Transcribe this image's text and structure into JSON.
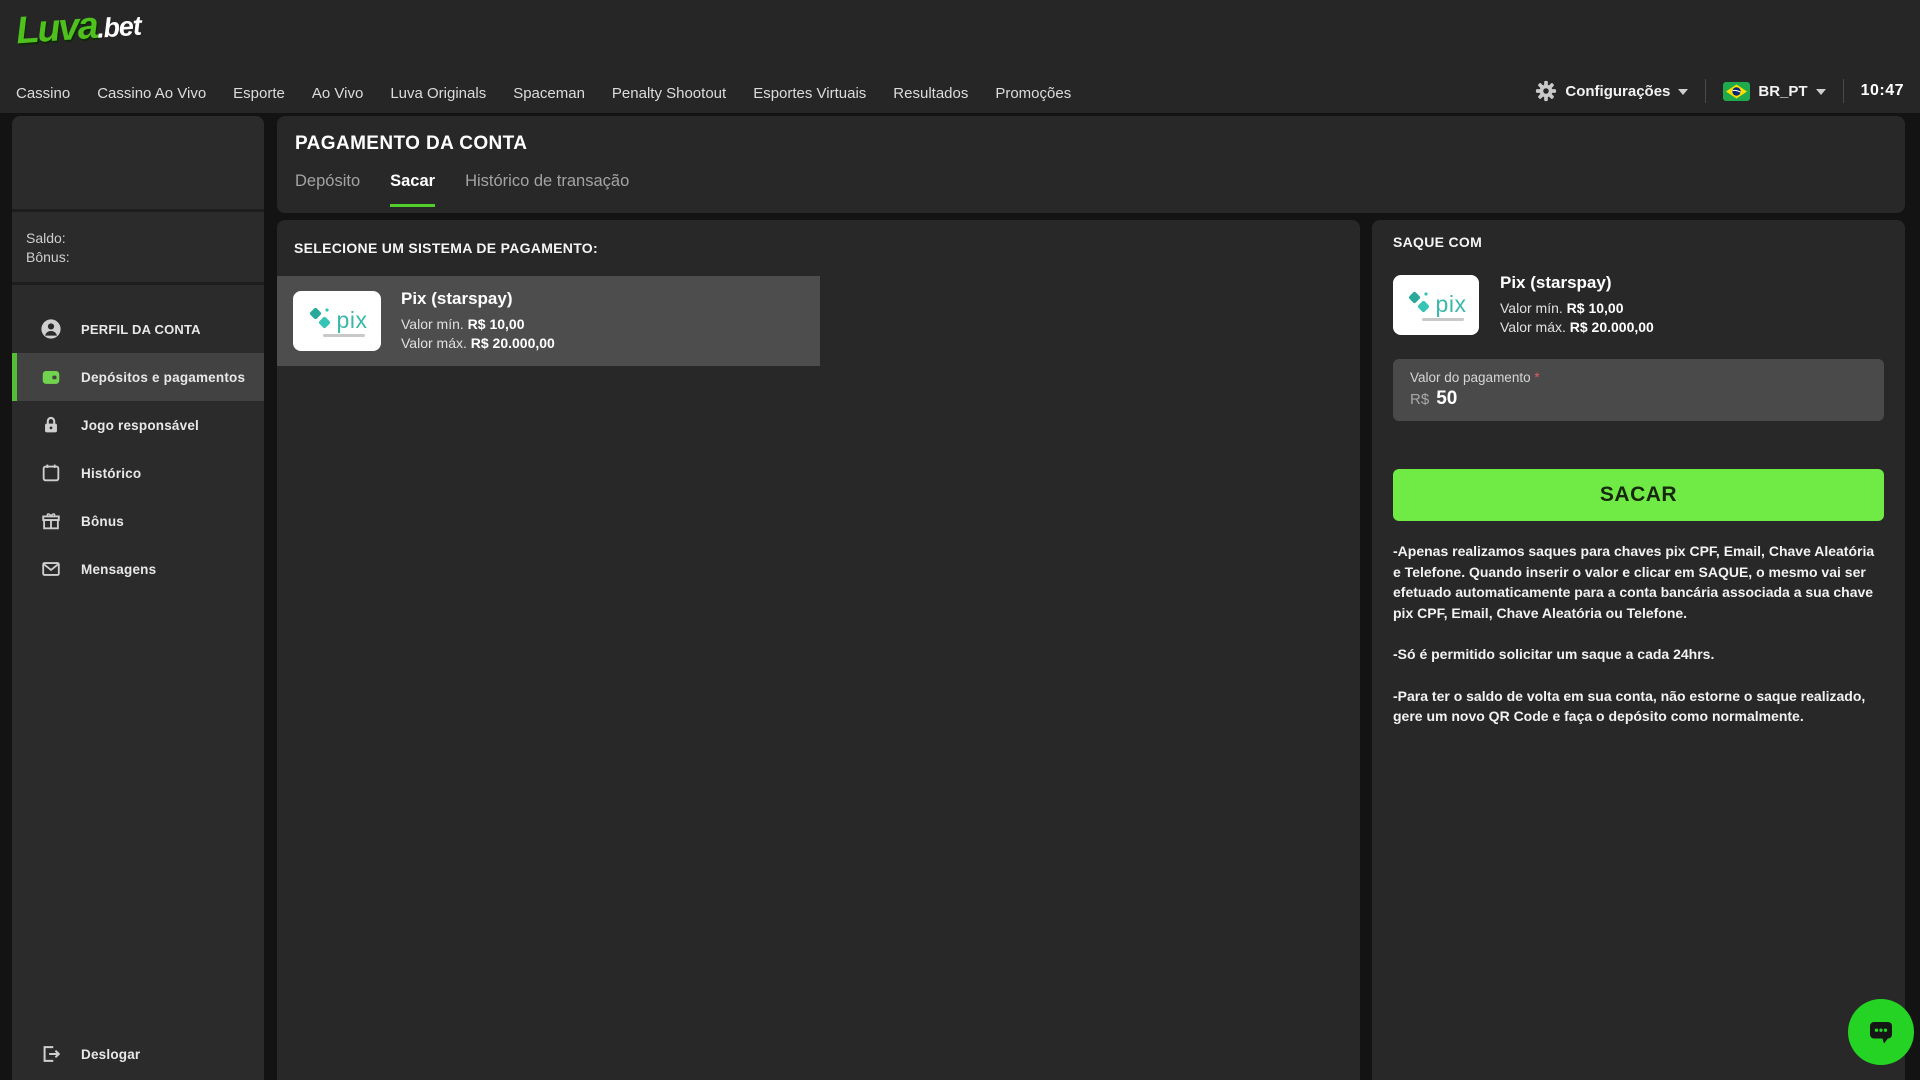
{
  "brand": {
    "logo_text": "Luva",
    "logo_suffix": ".bet"
  },
  "topnav": {
    "items": [
      "Cassino",
      "Cassino Ao Vivo",
      "Esporte",
      "Ao Vivo",
      "Luva Originals",
      "Spaceman",
      "Penalty Shootout",
      "Esportes Virtuais",
      "Resultados",
      "Promoções"
    ]
  },
  "topbar_right": {
    "settings_label": "Configurações",
    "language": "BR_PT",
    "time": "10:47"
  },
  "sidebar": {
    "balance": {
      "saldo_label": "Saldo:",
      "bonus_label": "Bônus:"
    },
    "items": [
      {
        "label": "PERFIL DA CONTA",
        "icon": "person"
      },
      {
        "label": "Depósitos e pagamentos",
        "icon": "wallet"
      },
      {
        "label": "Jogo responsável",
        "icon": "lock"
      },
      {
        "label": "Histórico",
        "icon": "calendar"
      },
      {
        "label": "Bônus",
        "icon": "gift"
      },
      {
        "label": "Mensagens",
        "icon": "envelope"
      }
    ],
    "logout_label": "Deslogar"
  },
  "payment": {
    "title": "PAGAMENTO DA CONTA",
    "tabs": [
      {
        "label": "Depósito"
      },
      {
        "label": "Sacar"
      },
      {
        "label": "Histórico de transação"
      }
    ],
    "select_header": "SELECIONE UM SISTEMA DE PAGAMENTO:",
    "method": {
      "name": "Pix (starspay)",
      "min_label": "Valor mín.",
      "min_value": "R$ 10,00",
      "max_label": "Valor máx.",
      "max_value": "R$ 20.000,00",
      "logo_text": "pix"
    },
    "withdraw": {
      "header": "SAQUE COM",
      "amount_label": "Valor do pagamento",
      "required_mark": "*",
      "currency": "R$",
      "amount_value": "50",
      "button_label": "SACAR",
      "notes": [
        "-Apenas realizamos saques para chaves pix CPF, Email, Chave Aleatória e Telefone. Quando inserir o valor e clicar em SAQUE, o mesmo vai ser efetuado automaticamente para a conta bancária associada a sua chave pix CPF, Email, Chave Aleatória ou Telefone.",
        "-Só é permitido solicitar um saque a cada 24hrs.",
        "-Para ter o saldo de volta em sua conta, não estorne o saque realizado, gere um novo QR Code e faça o depósito como normalmente."
      ]
    }
  },
  "colors": {
    "accent_lime": "#70ea45",
    "accent_green": "#55bd36",
    "tab_underline": "#50cf2c",
    "logo_green": "#4fc11d",
    "chat_green": "#25d325",
    "pix_teal": "#32bcad",
    "panel_bg": "#282828",
    "sidebar_bg": "#2b2b2b",
    "topbar_bg": "#262626",
    "page_bg": "#131313",
    "selected_card_bg": "#4d4d4d",
    "field_bg": "#4a4a4a",
    "required_red": "#e05c5c"
  }
}
